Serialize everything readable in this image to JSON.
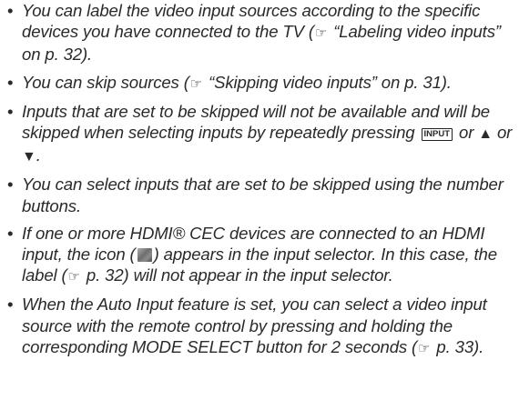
{
  "items": [
    {
      "t1": "You can label the video input sources according to the specific devices you have connected to the TV (",
      "t2": " “Labeling video inputs” on p. 32)."
    },
    {
      "t1": "You can skip sources (",
      "t2": " “Skipping video inputs” on p. 31)."
    },
    {
      "t1": "Inputs that are set to be skipped will not be available and will be skipped when selecting inputs by repeatedly pressing ",
      "key": "INPUT",
      "t2": " or ",
      "up": "▲",
      "t3": " or ",
      "down": "▼",
      "t4": "."
    },
    {
      "t1": "You can select inputs that are set to be skipped using the number buttons."
    },
    {
      "t1": "If one or more HDMI® CEC devices are connected to an HDMI input, the icon (",
      "t2": ") appears in the input selector. In this case, the label (",
      "t3": " p. 32) will not appear in the input selector."
    },
    {
      "t1": "When the Auto Input feature is set, you can select a video input source with the remote control by pressing and holding the corresponding MODE SELECT button for 2 seconds (",
      "t2": " p. 33)."
    }
  ],
  "icons": {
    "reference": "pointing-hand-icon",
    "reference_glyph": "☞",
    "cec": "hdmi-cec-icon"
  }
}
